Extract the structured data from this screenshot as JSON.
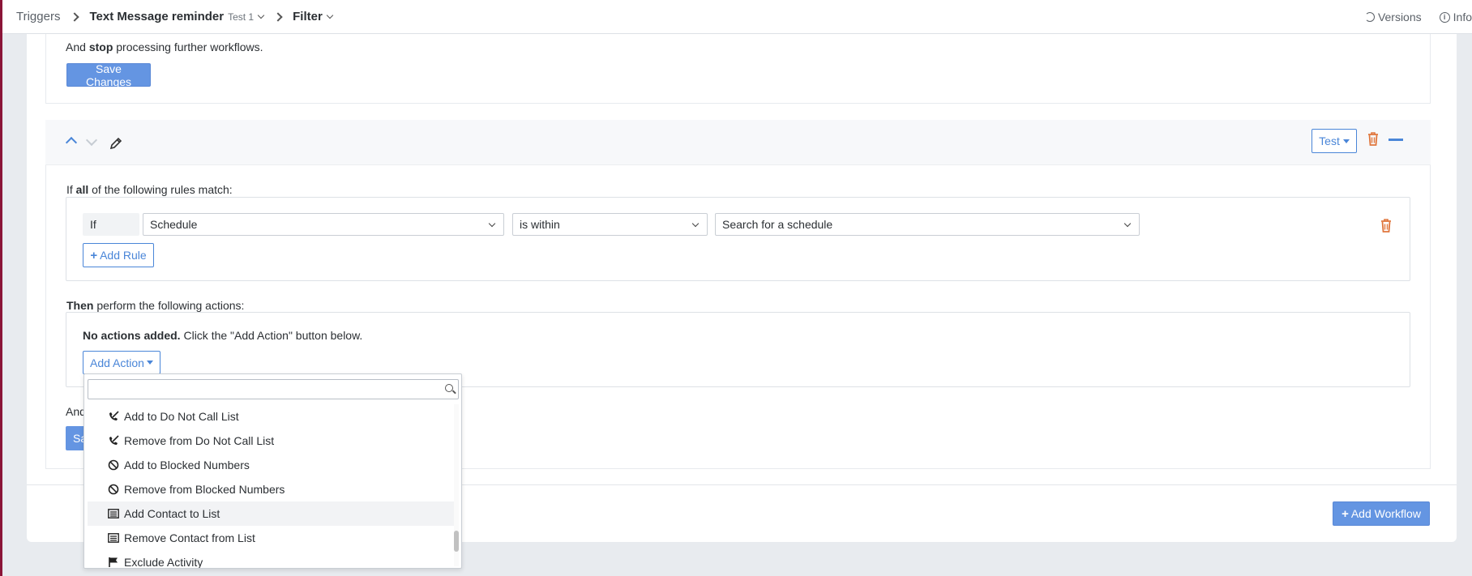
{
  "topbar": {
    "crumb1": "Triggers",
    "crumb2": "Text Message reminder",
    "crumb2_sub": "Test 1",
    "crumb3": "Filter",
    "versions": "Versions",
    "info": "Info"
  },
  "card1": {
    "text_pre": "And ",
    "text_bold": "stop",
    "text_post": " processing further workflows.",
    "save_label": "Save Changes"
  },
  "card2": {
    "test_label": "Test",
    "rules_pre": "If ",
    "rules_bold": "all",
    "rules_post": " of the following rules match:",
    "if_label": "If",
    "rule_field": "Schedule",
    "rule_operator": "is within",
    "rule_value": "Search for a schedule",
    "add_rule": "Add Rule",
    "actions_bold": "Then",
    "actions_post": " perform the following actions:",
    "no_actions_bold": "No actions added.",
    "no_actions_post": " Click the \"Add Action\" button below.",
    "add_action": "Add Action",
    "and_partial": "And",
    "save_partial": "Sa"
  },
  "footer": {
    "add_workflow": "Add Workflow"
  },
  "dropdown": {
    "search_value": "",
    "items": [
      {
        "label": "Add to Do Not Call List",
        "icon": "phone-slash-icon"
      },
      {
        "label": "Remove from Do Not Call List",
        "icon": "phone-slash-icon"
      },
      {
        "label": "Add to Blocked Numbers",
        "icon": "ban-icon"
      },
      {
        "label": "Remove from Blocked Numbers",
        "icon": "ban-icon"
      },
      {
        "label": "Add Contact to List",
        "icon": "list-icon"
      },
      {
        "label": "Remove Contact from List",
        "icon": "list-icon"
      },
      {
        "label": "Exclude Activity",
        "icon": "flag-icon"
      }
    ],
    "highlighted_index": 4
  },
  "colors": {
    "accent": "#4a86d8",
    "primary_button": "#6495e2",
    "danger": "#e0763c",
    "left_accent": "#8b1538"
  }
}
